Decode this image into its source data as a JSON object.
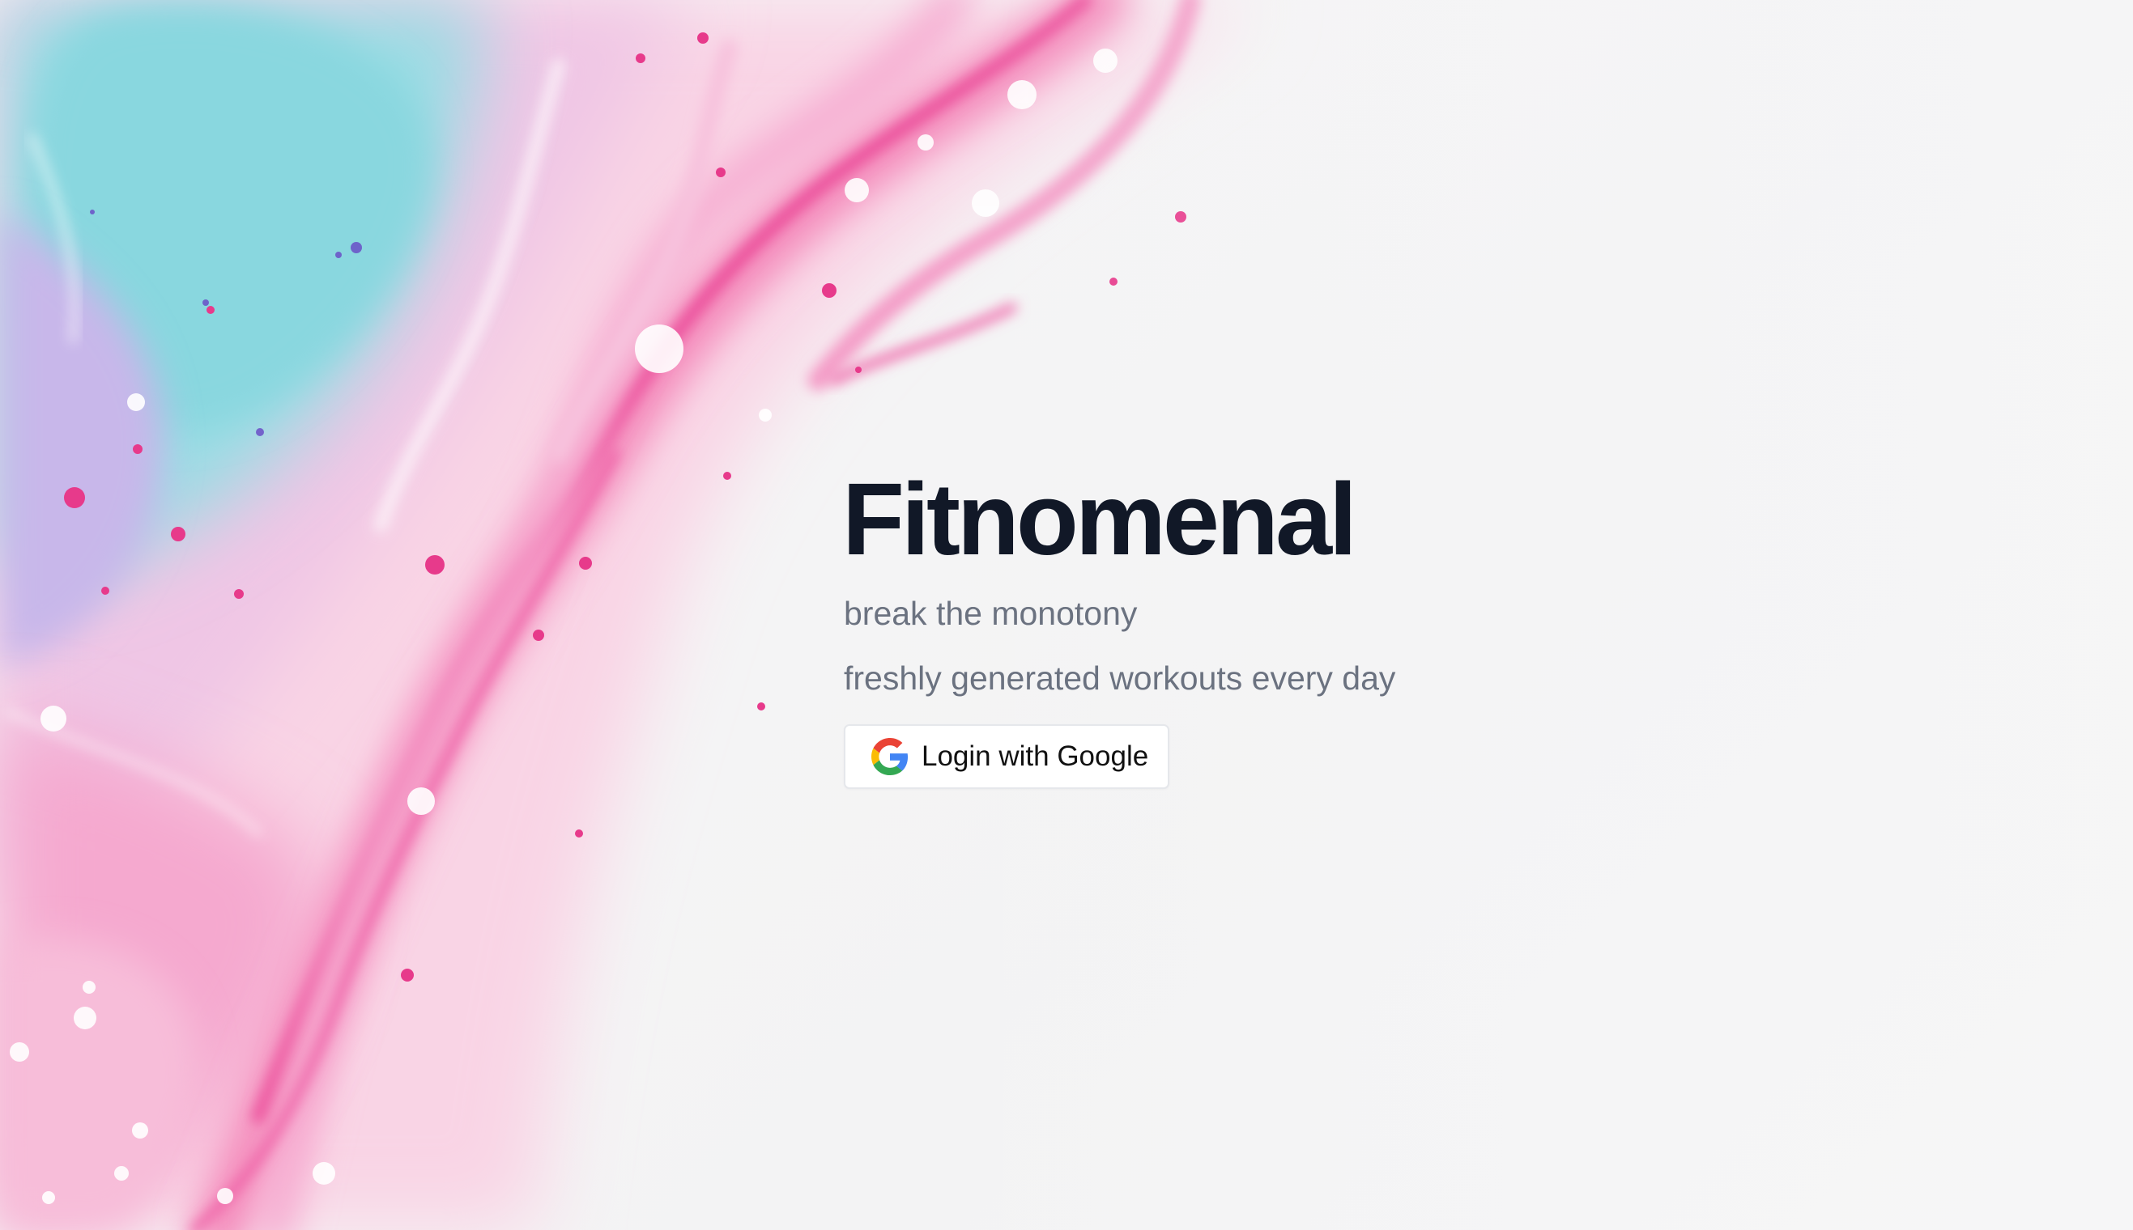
{
  "app": {
    "title": "Fitnomenal",
    "tagline": "break the monotony",
    "subtagline": "freshly generated workouts every day"
  },
  "login": {
    "label": "Login with Google",
    "icon": "google-icon"
  },
  "background": {
    "description_icon": "fluid-paint-art",
    "colors": {
      "base": "#f4f4f5",
      "pink": "#ef3f99",
      "light_pink": "#f8bfdc",
      "aqua": "#8fdde3",
      "lavender": "#c7b8ea"
    }
  },
  "colors": {
    "title": "#111827",
    "muted_text": "#6b7280",
    "button_border": "#e5e7eb"
  }
}
